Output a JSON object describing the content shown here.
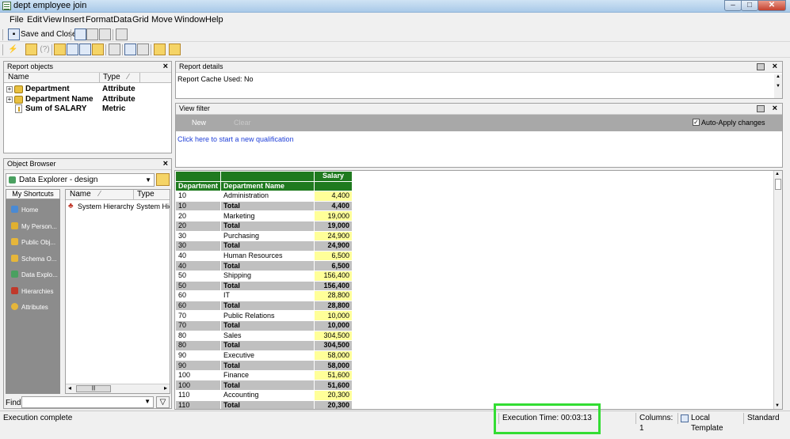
{
  "window": {
    "title": "dept employee join",
    "buttons": [
      "–",
      "□",
      "✕"
    ]
  },
  "menu": [
    "File",
    "Edit",
    "View",
    "Insert",
    "Format",
    "Data",
    "Grid",
    "Move",
    "Window",
    "Help"
  ],
  "toolbar": {
    "save_label": "Save and Close"
  },
  "report_objects": {
    "title": "Report objects",
    "columns": [
      "Name",
      "Type"
    ],
    "items": [
      {
        "name": "Department",
        "type": "Attribute",
        "icon": "attribute-icon"
      },
      {
        "name": "Department Name",
        "type": "Attribute",
        "icon": "attribute-icon"
      },
      {
        "name": "Sum of SALARY",
        "type": "Metric",
        "icon": "metric-icon"
      }
    ]
  },
  "object_browser": {
    "title": "Object Browser",
    "source": "Data Explorer - design",
    "shortcuts_tab": "My Shortcuts",
    "shortcuts": [
      {
        "label": "Home",
        "icon": "home-icon",
        "color": "#4a8ad4"
      },
      {
        "label": "My Person...",
        "icon": "my-personal-icon",
        "color": "#e0b030"
      },
      {
        "label": "Public Obj...",
        "icon": "folder-icon",
        "color": "#e6b63a"
      },
      {
        "label": "Schema O...",
        "icon": "folder-icon",
        "color": "#e6b63a"
      },
      {
        "label": "Data Explo...",
        "icon": "data-explorer-icon",
        "color": "#4aa060"
      },
      {
        "label": "Hierarchies",
        "icon": "hierarchy-icon",
        "color": "#c0392b"
      },
      {
        "label": "Attributes",
        "icon": "attribute-icon",
        "color": "#e6b63a"
      }
    ],
    "columns": [
      "Name",
      "Type"
    ],
    "rows": [
      {
        "name": "System Hierarchy",
        "type": "System Hie"
      }
    ],
    "find_label": "Find:"
  },
  "report_details": {
    "title": "Report details",
    "text": "Report Cache Used: No"
  },
  "view_filter": {
    "title": "View filter",
    "new_label": "New",
    "clear_label": "Clear",
    "auto_apply_label": "Auto-Apply changes",
    "auto_apply_checked": true,
    "qualification_link": "Click here to start a new qualification"
  },
  "grid": {
    "metric_header": "Salary",
    "col_headers": [
      "Department",
      "Department Name"
    ],
    "rows": [
      {
        "dept": "10",
        "name": "Administration",
        "salary": "4,400",
        "total": false
      },
      {
        "dept": "10",
        "name": "Total",
        "salary": "4,400",
        "total": true
      },
      {
        "dept": "20",
        "name": "Marketing",
        "salary": "19,000",
        "total": false
      },
      {
        "dept": "20",
        "name": "Total",
        "salary": "19,000",
        "total": true
      },
      {
        "dept": "30",
        "name": "Purchasing",
        "salary": "24,900",
        "total": false
      },
      {
        "dept": "30",
        "name": "Total",
        "salary": "24,900",
        "total": true
      },
      {
        "dept": "40",
        "name": "Human Resources",
        "salary": "6,500",
        "total": false
      },
      {
        "dept": "40",
        "name": "Total",
        "salary": "6,500",
        "total": true
      },
      {
        "dept": "50",
        "name": "Shipping",
        "salary": "156,400",
        "total": false
      },
      {
        "dept": "50",
        "name": "Total",
        "salary": "156,400",
        "total": true
      },
      {
        "dept": "60",
        "name": "IT",
        "salary": "28,800",
        "total": false
      },
      {
        "dept": "60",
        "name": "Total",
        "salary": "28,800",
        "total": true
      },
      {
        "dept": "70",
        "name": "Public Relations",
        "salary": "10,000",
        "total": false
      },
      {
        "dept": "70",
        "name": "Total",
        "salary": "10,000",
        "total": true
      },
      {
        "dept": "80",
        "name": "Sales",
        "salary": "304,500",
        "total": false
      },
      {
        "dept": "80",
        "name": "Total",
        "salary": "304,500",
        "total": true
      },
      {
        "dept": "90",
        "name": "Executive",
        "salary": "58,000",
        "total": false
      },
      {
        "dept": "90",
        "name": "Total",
        "salary": "58,000",
        "total": true
      },
      {
        "dept": "100",
        "name": "Finance",
        "salary": "51,600",
        "total": false
      },
      {
        "dept": "100",
        "name": "Total",
        "salary": "51,600",
        "total": true
      },
      {
        "dept": "110",
        "name": "Accounting",
        "salary": "20,300",
        "total": false
      },
      {
        "dept": "110",
        "name": "Total",
        "salary": "20,300",
        "total": true
      }
    ]
  },
  "status": {
    "message": "Execution complete",
    "execution_time": "Execution Time: 00:03:13",
    "columns": "Columns: 1",
    "template": "Local Template",
    "mode": "Standard"
  },
  "colors": {
    "grid_header": "#1f7a1f",
    "salary_cell": "#ffff99",
    "total_row": "#c0c0c0",
    "highlight": "#33dd33"
  }
}
